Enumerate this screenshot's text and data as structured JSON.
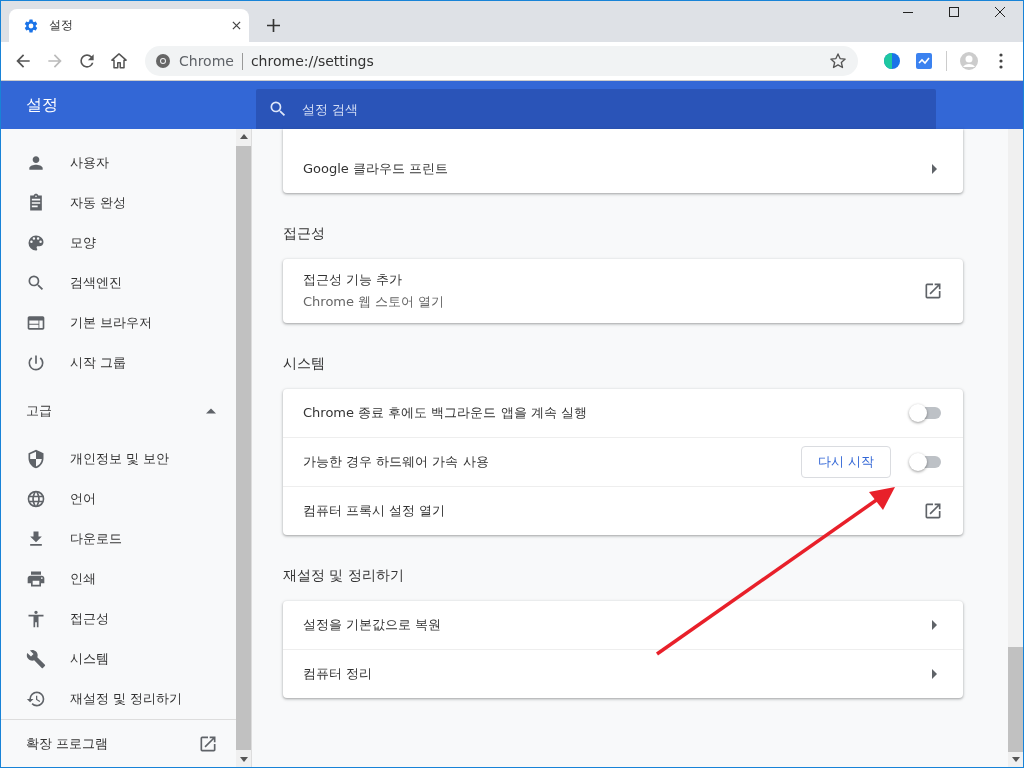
{
  "tab": {
    "title": "설정",
    "selected": true
  },
  "toolbar": {
    "forward_disabled": true,
    "site_label": "Chrome",
    "url": "chrome://settings"
  },
  "header": {
    "title": "설정",
    "search": {
      "placeholder": "설정 검색"
    }
  },
  "sidebar": {
    "items": [
      {
        "label": "사용자"
      },
      {
        "label": "자동 완성"
      },
      {
        "label": "모양"
      },
      {
        "label": "검색엔진"
      },
      {
        "label": "기본 브라우저"
      },
      {
        "label": "시작 그룹"
      }
    ],
    "advanced": {
      "label": "고급",
      "expanded": true,
      "items": [
        {
          "label": "개인정보 및 보안"
        },
        {
          "label": "언어"
        },
        {
          "label": "다운로드"
        },
        {
          "label": "인쇄"
        },
        {
          "label": "접근성"
        },
        {
          "label": "시스템"
        },
        {
          "label": "재설정 및 정리하기"
        }
      ]
    },
    "extensions": {
      "label": "확장 프로그램"
    }
  },
  "sections": [
    {
      "rows": [
        {
          "kind": "arrow",
          "label": "Google 클라우드 프린트"
        }
      ]
    },
    {
      "title": "접근성",
      "rows": [
        {
          "kind": "external",
          "label": "접근성 기능 추가",
          "sublabel": "Chrome 웹 스토어 열기"
        }
      ]
    },
    {
      "title": "시스템",
      "rows": [
        {
          "kind": "toggle",
          "label": "Chrome 종료 후에도 백그라운드 앱을 계속 실행",
          "on": false
        },
        {
          "kind": "toggle",
          "label": "가능한 경우 하드웨어 가속 사용",
          "button": "다시 시작",
          "on": false
        },
        {
          "kind": "external",
          "label": "컴퓨터 프록시 설정 열기"
        }
      ]
    },
    {
      "title": "재설정 및 정리하기",
      "rows": [
        {
          "kind": "arrow",
          "label": "설정을 기본값으로 복원"
        },
        {
          "kind": "arrow",
          "label": "컴퓨터 정리"
        }
      ]
    }
  ]
}
